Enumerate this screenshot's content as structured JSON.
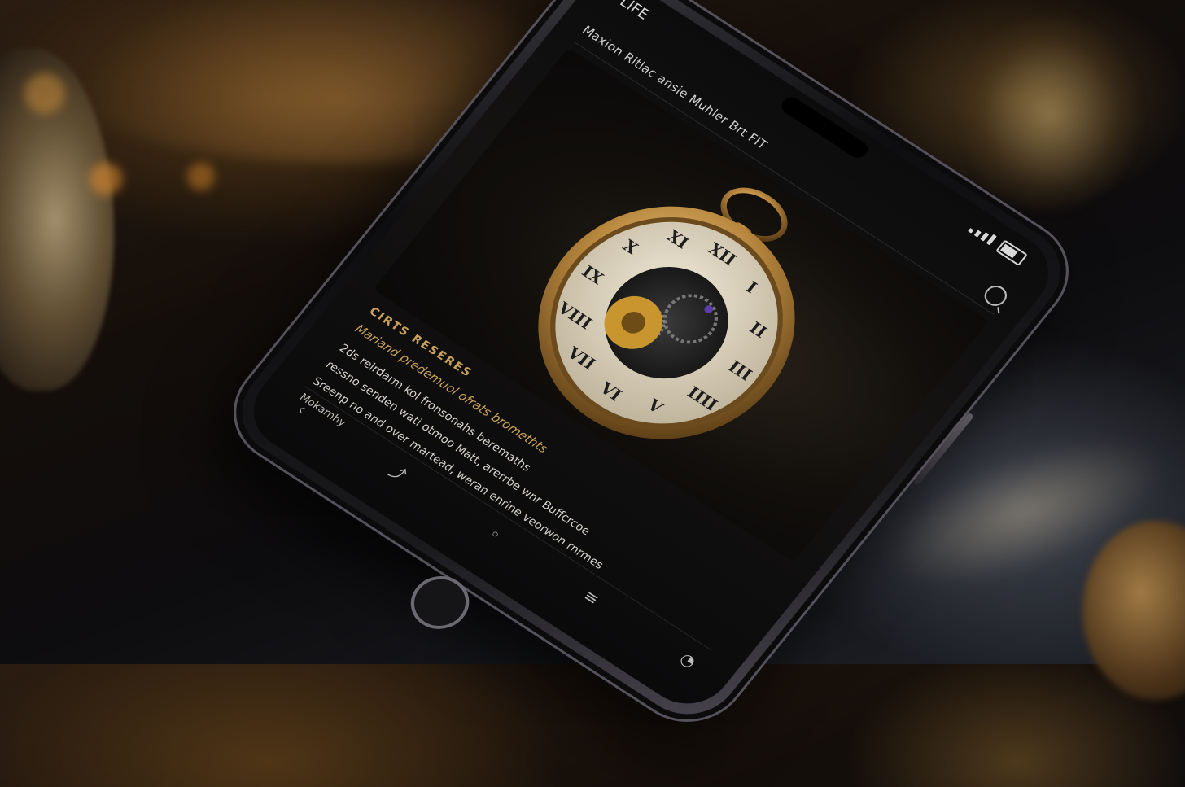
{
  "status_bar": {
    "carrier": "LIFE",
    "time": ""
  },
  "app_header": {
    "title": "Maxion Ritlac ansie Muhler Brt FIT"
  },
  "content": {
    "eyebrow": "CIRTS RESERES",
    "subtitle": "Mariand predemuol ofrats bromethts",
    "paragraph_1": "2ds relrdarm kol fronsonahs beremaths",
    "paragraph_2": "ressno senden wati otmoo Matt, arerrbe wnr Buffcrcoe",
    "paragraph_3": "Sreenp no and over martead, weran enrine veorwon rnrmes",
    "note": "Mokarnhy"
  },
  "watch": {
    "numerals": [
      "XII",
      "I",
      "II",
      "III",
      "IIII",
      "V",
      "VI",
      "VII",
      "VIII",
      "IX",
      "X",
      "XI"
    ]
  },
  "nav": {
    "icons": [
      "back-icon",
      "share-icon",
      "home-icon",
      "menu-icon",
      "profile-icon"
    ]
  },
  "colors": {
    "accent_gold": "#c9a15a",
    "screen_bg": "#0c0c0d",
    "watch_case": "#b8873e",
    "dial": "#e8e1d0"
  }
}
